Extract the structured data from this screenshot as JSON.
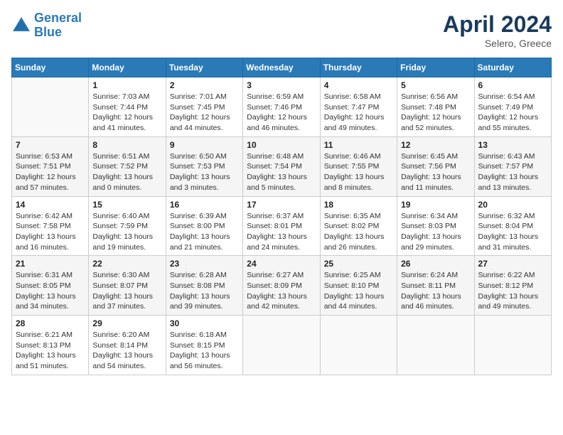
{
  "header": {
    "logo_line1": "General",
    "logo_line2": "Blue",
    "month": "April 2024",
    "location": "Selero, Greece"
  },
  "weekdays": [
    "Sunday",
    "Monday",
    "Tuesday",
    "Wednesday",
    "Thursday",
    "Friday",
    "Saturday"
  ],
  "weeks": [
    [
      {
        "day": "",
        "info": ""
      },
      {
        "day": "1",
        "info": "Sunrise: 7:03 AM\nSunset: 7:44 PM\nDaylight: 12 hours\nand 41 minutes."
      },
      {
        "day": "2",
        "info": "Sunrise: 7:01 AM\nSunset: 7:45 PM\nDaylight: 12 hours\nand 44 minutes."
      },
      {
        "day": "3",
        "info": "Sunrise: 6:59 AM\nSunset: 7:46 PM\nDaylight: 12 hours\nand 46 minutes."
      },
      {
        "day": "4",
        "info": "Sunrise: 6:58 AM\nSunset: 7:47 PM\nDaylight: 12 hours\nand 49 minutes."
      },
      {
        "day": "5",
        "info": "Sunrise: 6:56 AM\nSunset: 7:48 PM\nDaylight: 12 hours\nand 52 minutes."
      },
      {
        "day": "6",
        "info": "Sunrise: 6:54 AM\nSunset: 7:49 PM\nDaylight: 12 hours\nand 55 minutes."
      }
    ],
    [
      {
        "day": "7",
        "info": "Sunrise: 6:53 AM\nSunset: 7:51 PM\nDaylight: 12 hours\nand 57 minutes."
      },
      {
        "day": "8",
        "info": "Sunrise: 6:51 AM\nSunset: 7:52 PM\nDaylight: 13 hours\nand 0 minutes."
      },
      {
        "day": "9",
        "info": "Sunrise: 6:50 AM\nSunset: 7:53 PM\nDaylight: 13 hours\nand 3 minutes."
      },
      {
        "day": "10",
        "info": "Sunrise: 6:48 AM\nSunset: 7:54 PM\nDaylight: 13 hours\nand 5 minutes."
      },
      {
        "day": "11",
        "info": "Sunrise: 6:46 AM\nSunset: 7:55 PM\nDaylight: 13 hours\nand 8 minutes."
      },
      {
        "day": "12",
        "info": "Sunrise: 6:45 AM\nSunset: 7:56 PM\nDaylight: 13 hours\nand 11 minutes."
      },
      {
        "day": "13",
        "info": "Sunrise: 6:43 AM\nSunset: 7:57 PM\nDaylight: 13 hours\nand 13 minutes."
      }
    ],
    [
      {
        "day": "14",
        "info": "Sunrise: 6:42 AM\nSunset: 7:58 PM\nDaylight: 13 hours\nand 16 minutes."
      },
      {
        "day": "15",
        "info": "Sunrise: 6:40 AM\nSunset: 7:59 PM\nDaylight: 13 hours\nand 19 minutes."
      },
      {
        "day": "16",
        "info": "Sunrise: 6:39 AM\nSunset: 8:00 PM\nDaylight: 13 hours\nand 21 minutes."
      },
      {
        "day": "17",
        "info": "Sunrise: 6:37 AM\nSunset: 8:01 PM\nDaylight: 13 hours\nand 24 minutes."
      },
      {
        "day": "18",
        "info": "Sunrise: 6:35 AM\nSunset: 8:02 PM\nDaylight: 13 hours\nand 26 minutes."
      },
      {
        "day": "19",
        "info": "Sunrise: 6:34 AM\nSunset: 8:03 PM\nDaylight: 13 hours\nand 29 minutes."
      },
      {
        "day": "20",
        "info": "Sunrise: 6:32 AM\nSunset: 8:04 PM\nDaylight: 13 hours\nand 31 minutes."
      }
    ],
    [
      {
        "day": "21",
        "info": "Sunrise: 6:31 AM\nSunset: 8:05 PM\nDaylight: 13 hours\nand 34 minutes."
      },
      {
        "day": "22",
        "info": "Sunrise: 6:30 AM\nSunset: 8:07 PM\nDaylight: 13 hours\nand 37 minutes."
      },
      {
        "day": "23",
        "info": "Sunrise: 6:28 AM\nSunset: 8:08 PM\nDaylight: 13 hours\nand 39 minutes."
      },
      {
        "day": "24",
        "info": "Sunrise: 6:27 AM\nSunset: 8:09 PM\nDaylight: 13 hours\nand 42 minutes."
      },
      {
        "day": "25",
        "info": "Sunrise: 6:25 AM\nSunset: 8:10 PM\nDaylight: 13 hours\nand 44 minutes."
      },
      {
        "day": "26",
        "info": "Sunrise: 6:24 AM\nSunset: 8:11 PM\nDaylight: 13 hours\nand 46 minutes."
      },
      {
        "day": "27",
        "info": "Sunrise: 6:22 AM\nSunset: 8:12 PM\nDaylight: 13 hours\nand 49 minutes."
      }
    ],
    [
      {
        "day": "28",
        "info": "Sunrise: 6:21 AM\nSunset: 8:13 PM\nDaylight: 13 hours\nand 51 minutes."
      },
      {
        "day": "29",
        "info": "Sunrise: 6:20 AM\nSunset: 8:14 PM\nDaylight: 13 hours\nand 54 minutes."
      },
      {
        "day": "30",
        "info": "Sunrise: 6:18 AM\nSunset: 8:15 PM\nDaylight: 13 hours\nand 56 minutes."
      },
      {
        "day": "",
        "info": ""
      },
      {
        "day": "",
        "info": ""
      },
      {
        "day": "",
        "info": ""
      },
      {
        "day": "",
        "info": ""
      }
    ]
  ]
}
